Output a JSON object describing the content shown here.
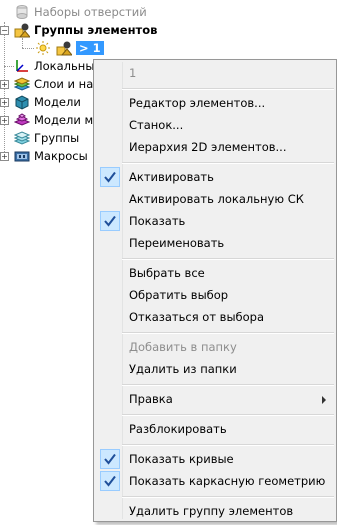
{
  "tree": {
    "nodes": [
      {
        "label": "Наборы отверстий"
      },
      {
        "label": "Группы элементов"
      },
      {
        "label": "> 1"
      },
      {
        "label": "Локальные"
      },
      {
        "label": "Слои и наб"
      },
      {
        "label": "Модели"
      },
      {
        "label": "Модели ма"
      },
      {
        "label": "Группы"
      },
      {
        "label": "Макросы"
      }
    ]
  },
  "menu": {
    "header": "1",
    "items": [
      {
        "label": "Редактор элементов..."
      },
      {
        "label": "Станок..."
      },
      {
        "label": "Иерархия 2D элементов..."
      },
      {
        "label": "Активировать",
        "checked": true
      },
      {
        "label": "Активировать локальную СК"
      },
      {
        "label": "Показать",
        "checked": true
      },
      {
        "label": "Переименовать"
      },
      {
        "label": "Выбрать все"
      },
      {
        "label": "Обратить выбор"
      },
      {
        "label": "Отказаться от выбора"
      },
      {
        "label": "Добавить в папку",
        "disabled": true
      },
      {
        "label": "Удалить из папки"
      },
      {
        "label": "Правка",
        "submenu": true
      },
      {
        "label": "Разблокировать"
      },
      {
        "label": "Показать кривые",
        "checked": true
      },
      {
        "label": "Показать каркасную геометрию",
        "checked": true
      },
      {
        "label": "Удалить группу элементов"
      }
    ]
  },
  "colors": {
    "selection": "#3399ff",
    "check_box": "#cce8ff",
    "check_mark": "#1f4f9a",
    "menu_bg": "#f0f0f0",
    "disabled_text": "#8d8d8d"
  }
}
